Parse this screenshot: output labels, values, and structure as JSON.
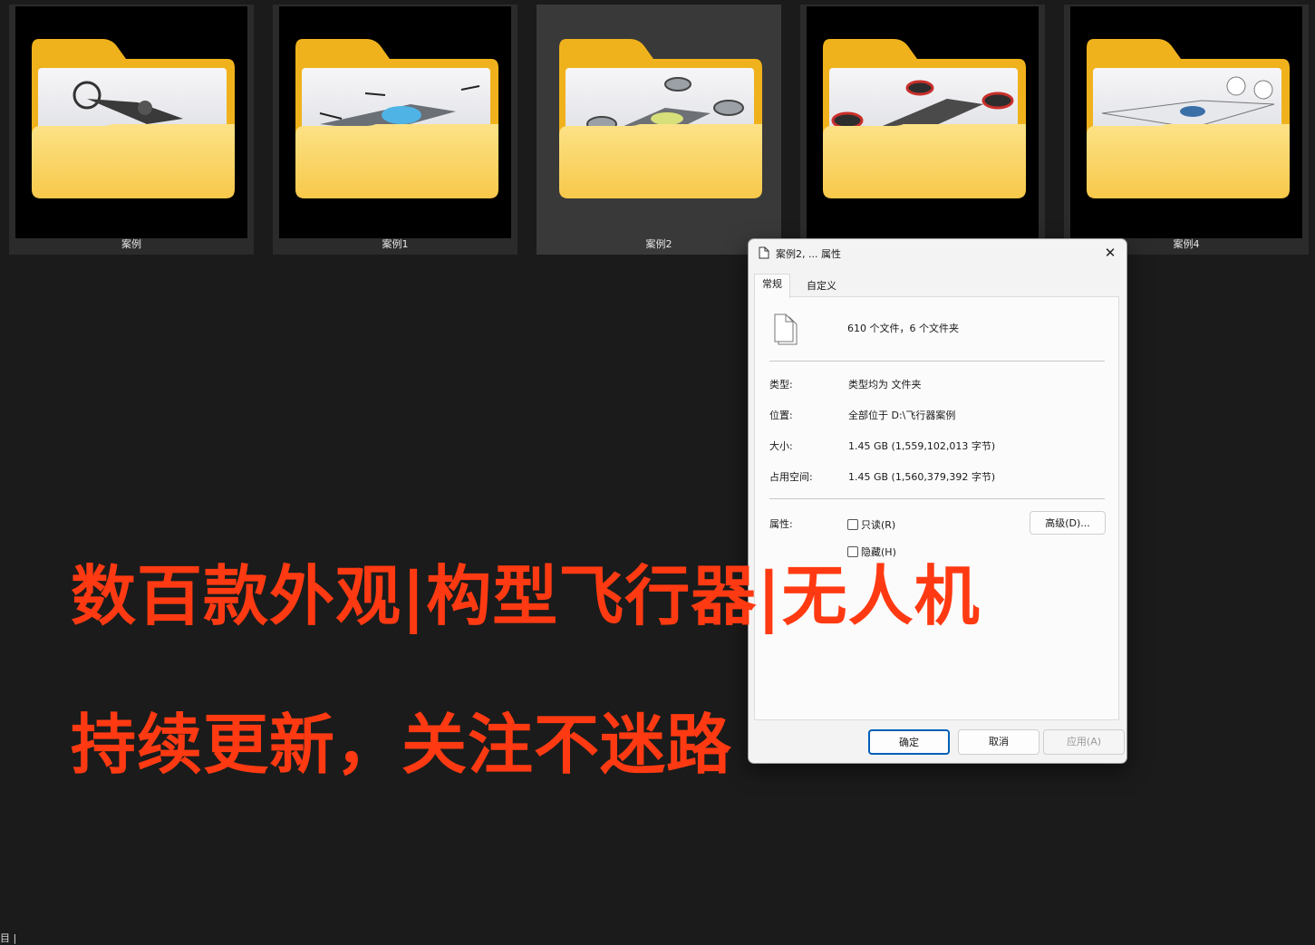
{
  "folders": [
    {
      "label": "案例",
      "selected": false
    },
    {
      "label": "案例1",
      "selected": false
    },
    {
      "label": "案例2",
      "selected": true
    },
    {
      "label": "",
      "selected": false
    },
    {
      "label": "案例4",
      "selected": false
    }
  ],
  "overlay": {
    "line1": "数百款外观|构型飞行器|无人机",
    "line2": "持续更新，关注不迷路",
    "color": "#ff3a12"
  },
  "dialog": {
    "title": "案例2, ... 属性",
    "close_glyph": "✕",
    "tabs": [
      "常规",
      "自定义"
    ],
    "summary": "610 个文件，6 个文件夹",
    "props": [
      {
        "label": "类型:",
        "value": "类型均为 文件夹"
      },
      {
        "label": "位置:",
        "value": "全部位于 D:\\飞行器案例"
      },
      {
        "label": "大小:",
        "value": "1.45 GB (1,559,102,013 字节)"
      },
      {
        "label": "占用空间:",
        "value": "1.45 GB (1,560,379,392 字节)"
      }
    ],
    "attributes_label": "属性:",
    "readonly_label": "只读(R)",
    "hidden_label": "隐藏(H)",
    "advanced_label": "高级(D)...",
    "ok_label": "确定",
    "cancel_label": "取消",
    "apply_label": "应用(A)"
  },
  "taskbar_fragment": "目 |"
}
